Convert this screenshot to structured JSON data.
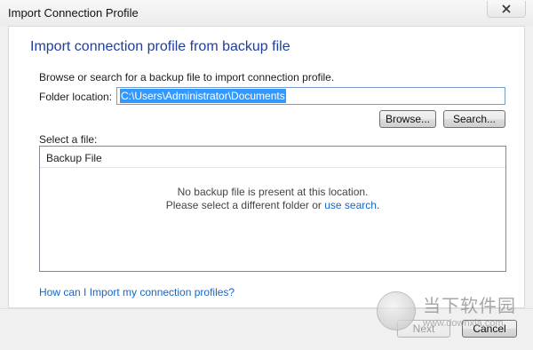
{
  "window": {
    "title": "Import Connection Profile",
    "close_glyph": "✕"
  },
  "main": {
    "heading": "Import connection profile from backup file",
    "instruction": "Browse or search for a backup file to import connection profile.",
    "folder_label": "Folder location:",
    "folder_value": "C:\\Users\\Administrator\\Documents",
    "browse_label": "Browse...",
    "search_label": "Search...",
    "select_label": "Select a file:",
    "list": {
      "column_header": "Backup File",
      "empty_line1": "No backup file is present at this location.",
      "empty_line2_prefix": "Please select a different folder or ",
      "empty_line2_link": "use search",
      "empty_line2_suffix": "."
    },
    "help_link": "How can I Import my connection profiles?"
  },
  "footer": {
    "next_label": "Next",
    "cancel_label": "Cancel"
  },
  "watermark": {
    "text": "当下软件园",
    "url": "www.downxia.com"
  },
  "colors": {
    "heading": "#1f3f9f",
    "link": "#1a66c2",
    "selection": "#3399ff"
  }
}
